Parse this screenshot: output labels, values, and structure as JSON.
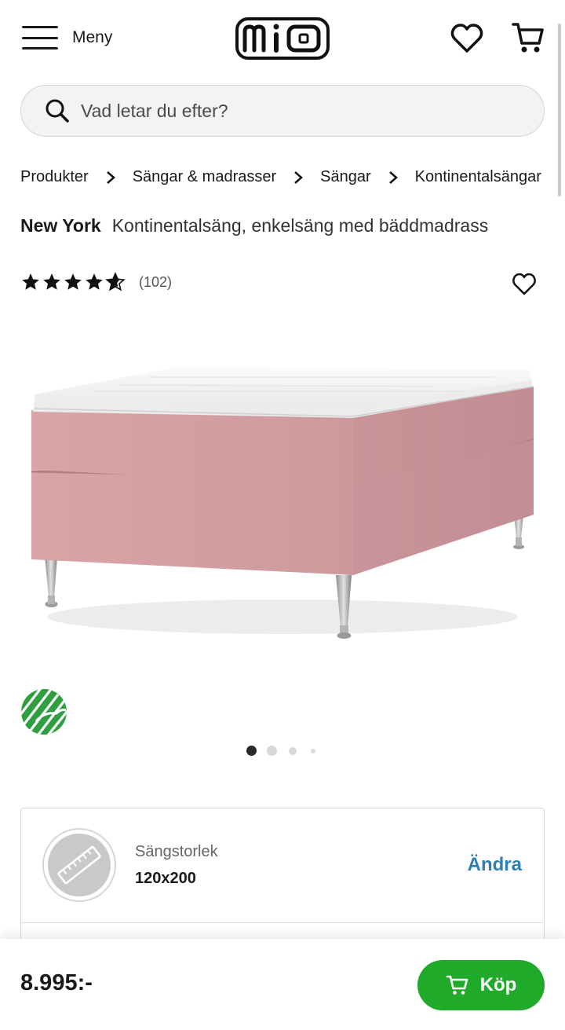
{
  "header": {
    "menu_label": "Meny",
    "logo_text": "mio",
    "icons": [
      "hamburger-icon",
      "heart-icon",
      "cart-icon"
    ]
  },
  "search": {
    "placeholder": "Vad letar du efter?"
  },
  "breadcrumb": [
    "Produkter",
    "Sängar & madrasser",
    "Sängar",
    "Kontinentalsängar"
  ],
  "product": {
    "name": "New York",
    "description": "Kontinentalsäng, enkelsäng med bäddmadrass",
    "rating_stars": 4.5,
    "rating_count": "(102)",
    "image_colors": {
      "fabric": "#d9a5a8",
      "mattress": "#f4f4f4",
      "legs": "#b8b8b8"
    },
    "eco_label_color": "#2f9e3f"
  },
  "carousel": {
    "slides": 4,
    "active_index": 0
  },
  "option": {
    "label": "Sängstorlek",
    "value": "120x200",
    "change_label": "Ändra",
    "icon": "ruler-icon"
  },
  "buy_bar": {
    "price": "8.995:-",
    "button_label": "Köp",
    "button_color": "#1faa2a"
  }
}
